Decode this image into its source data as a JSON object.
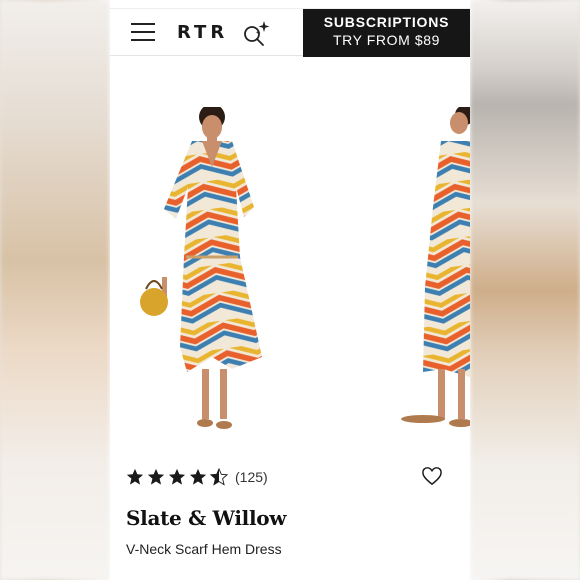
{
  "header": {
    "logo": "RTR",
    "menu_icon": "hamburger-menu-icon",
    "search_icon": "sparkle-search-icon",
    "subscriptions_title": "SUBSCRIPTIONS",
    "subscriptions_subtitle": "TRY FROM $89"
  },
  "product": {
    "rating_stars": 4.5,
    "rating_count": "(125)",
    "brand": "Slate & Willow",
    "name": "V-Neck Scarf Hem Dress",
    "favorite_icon": "heart-outline-icon"
  },
  "colors": {
    "header_cta_bg": "#161616",
    "text": "#111111",
    "dress_orange": "#e8602c",
    "dress_yellow": "#e9b530",
    "dress_blue": "#3d7fb1",
    "dress_cream": "#f1e8d8"
  }
}
